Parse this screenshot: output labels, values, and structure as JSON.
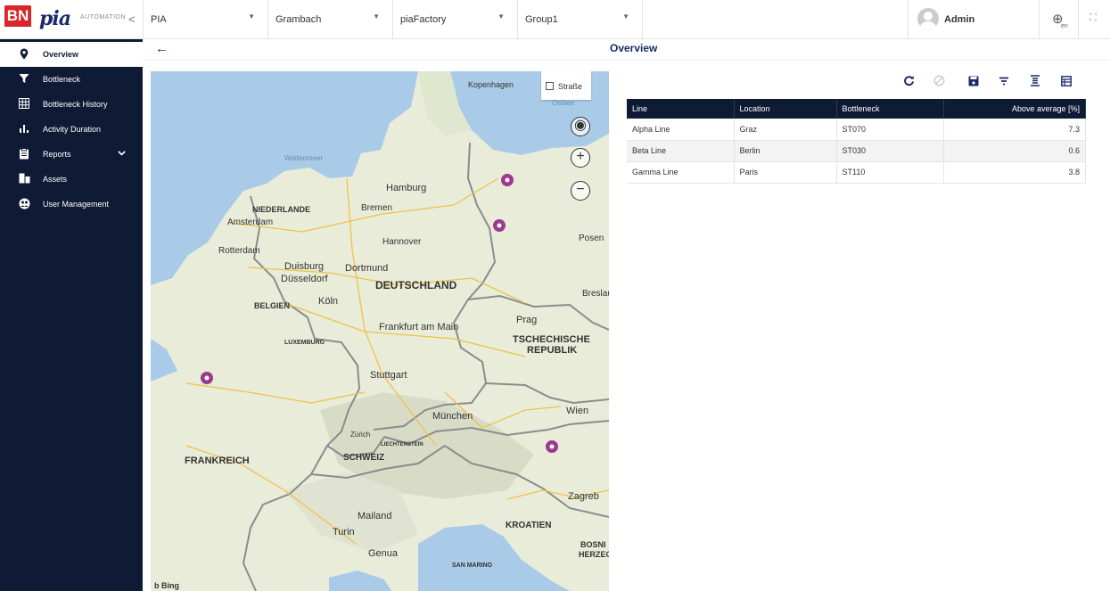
{
  "brand": {
    "logo_letters": "BN",
    "product": "pia",
    "product_sub": "AUTOMATION"
  },
  "filters": [
    {
      "label": "PIA"
    },
    {
      "label": "Grambach"
    },
    {
      "label": "piaFactory"
    },
    {
      "label": "Group1"
    },
    {
      "label": ""
    }
  ],
  "user": {
    "name": "Admin"
  },
  "language": {
    "code": "en"
  },
  "sidebar": {
    "items": [
      {
        "label": "Overview",
        "icon": "location-pin-icon",
        "active": true
      },
      {
        "label": "Bottleneck",
        "icon": "funnel-icon"
      },
      {
        "label": "Bottleneck History",
        "icon": "grid-icon"
      },
      {
        "label": "Activity Duration",
        "icon": "bar-chart-icon"
      },
      {
        "label": "Reports",
        "icon": "clipboard-icon",
        "expandable": true
      },
      {
        "label": "Assets",
        "icon": "assets-icon"
      },
      {
        "label": "User Management",
        "icon": "users-icon"
      }
    ]
  },
  "page": {
    "title": "Overview"
  },
  "map": {
    "layer_button": "Straße",
    "attribution": "Bing",
    "places": [
      {
        "label": "Kopenhagen"
      },
      {
        "label": "Ostsee"
      },
      {
        "label": "Wattenmeer"
      },
      {
        "label": "NIEDERLANDE"
      },
      {
        "label": "Amsterdam"
      },
      {
        "label": "Rotterdam"
      },
      {
        "label": "Hamburg"
      },
      {
        "label": "Bremen"
      },
      {
        "label": "Hannover"
      },
      {
        "label": "Duisburg"
      },
      {
        "label": "Dortmund"
      },
      {
        "label": "Düsseldorf"
      },
      {
        "label": "Köln"
      },
      {
        "label": "DEUTSCHLAND"
      },
      {
        "label": "BELGIEN"
      },
      {
        "label": "LUXEMBURG"
      },
      {
        "label": "Frankfurt am Main"
      },
      {
        "label": "Prag"
      },
      {
        "label": "TSCHECHISCHE"
      },
      {
        "label": "REPUBLIK"
      },
      {
        "label": "Stuttgart"
      },
      {
        "label": "München"
      },
      {
        "label": "Wien"
      },
      {
        "label": "Zürich"
      },
      {
        "label": "SCHWEIZ"
      },
      {
        "label": "LIECHTENSTEIN"
      },
      {
        "label": "FRANKREICH"
      },
      {
        "label": "Posen"
      },
      {
        "label": "Breslau"
      },
      {
        "label": "Zagreb"
      },
      {
        "label": "KROATIEN"
      },
      {
        "label": "Mailand"
      },
      {
        "label": "Turin"
      },
      {
        "label": "Genua"
      },
      {
        "label": "SAN MARINO"
      },
      {
        "label": "BOSNI"
      },
      {
        "label": "HERZEG"
      }
    ],
    "markers": [
      {
        "name": "marker-berlin-north"
      },
      {
        "name": "marker-berlin"
      },
      {
        "name": "marker-paris"
      },
      {
        "name": "marker-graz"
      }
    ]
  },
  "toolbar": {
    "refresh_icon": "refresh-icon",
    "cancel_icon": "cancel-icon",
    "save_icon": "save-icon",
    "filter_icon": "filter-icon",
    "align_icon": "align-icon",
    "columns_icon": "columns-icon"
  },
  "table": {
    "headers": [
      "Line",
      "Location",
      "Bottleneck",
      "Above average [%]"
    ],
    "rows": [
      [
        "Alpha Line",
        "Graz",
        "ST070",
        "7.3"
      ],
      [
        "Beta Line",
        "Berlin",
        "ST030",
        "0.6"
      ],
      [
        "Gamma Line",
        "Paris",
        "ST110",
        "3.8"
      ]
    ]
  },
  "colors": {
    "sidebar": "#0f1b35",
    "accent": "#1b2a6b",
    "brand_red": "#d9262b",
    "marker": "#9b3a8f"
  }
}
